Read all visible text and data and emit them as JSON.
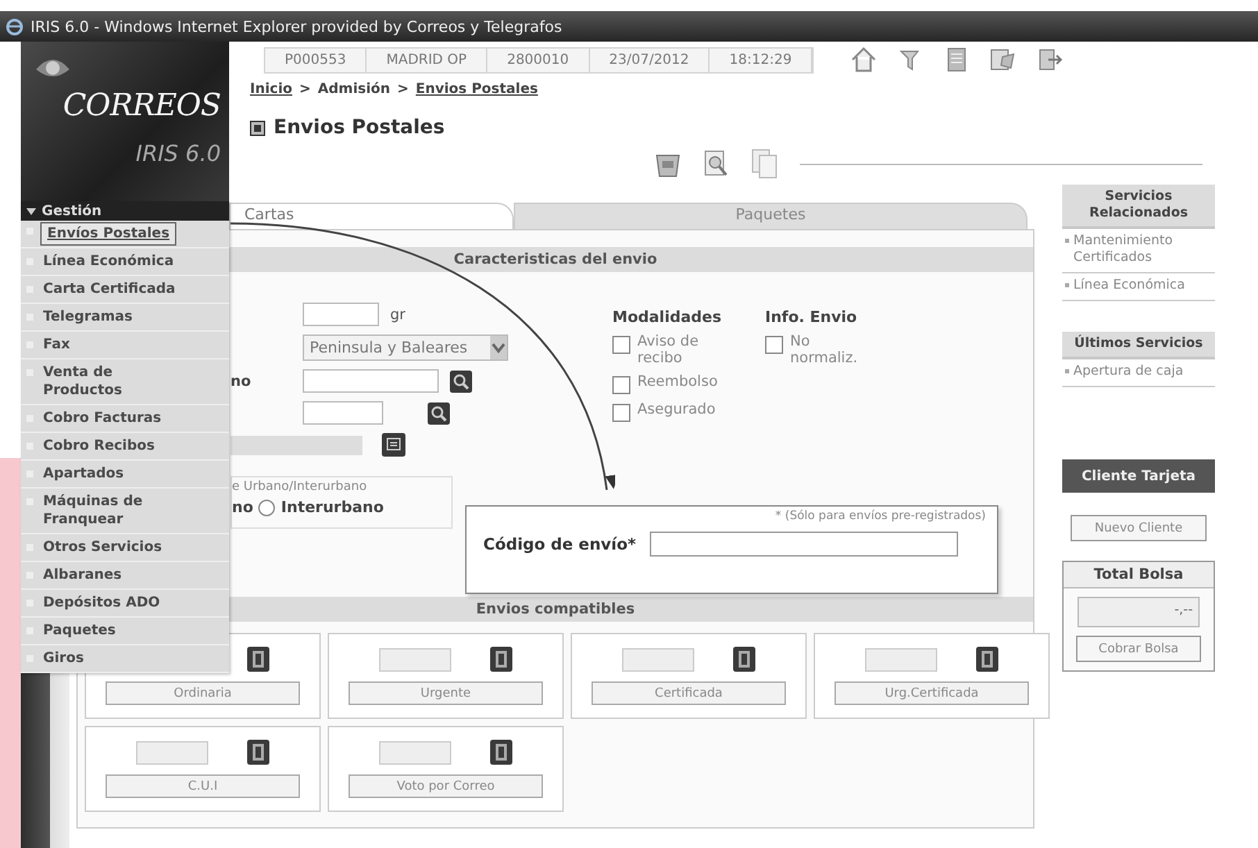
{
  "window": {
    "title": "IRIS 6.0 - Windows Internet Explorer provided by Correos y Telegrafos"
  },
  "logo": {
    "brand": "CORREOS",
    "product": "IRIS 6.0"
  },
  "header": {
    "info": [
      "P000553",
      "MADRID OP",
      "2800010",
      "23/07/2012",
      "18:12:29"
    ],
    "breadcrumb": [
      {
        "label": "Inicio",
        "link": true
      },
      {
        "label": ">",
        "link": false
      },
      {
        "label": "Admisión",
        "link": false
      },
      {
        "label": ">",
        "link": false
      },
      {
        "label": "Envios Postales",
        "link": true
      }
    ],
    "page_title": "Envios Postales"
  },
  "menu": {
    "title": "Gestión",
    "items": [
      {
        "label": "Envíos Postales",
        "selected": true
      },
      {
        "label": "Línea Económica",
        "selected": false
      },
      {
        "label": "Carta Certificada",
        "selected": false
      },
      {
        "label": "Telegramas",
        "selected": false
      },
      {
        "label": "Fax",
        "selected": false
      },
      {
        "label": "Venta de Productos",
        "selected": false
      },
      {
        "label": "Cobro Facturas",
        "selected": false
      },
      {
        "label": "Cobro Recibos",
        "selected": false
      },
      {
        "label": "Apartados",
        "selected": false
      },
      {
        "label": "Máquinas de Franquear",
        "selected": false
      },
      {
        "label": "Otros Servicios",
        "selected": false
      },
      {
        "label": "Albaranes",
        "selected": false
      },
      {
        "label": "Depósitos ADO",
        "selected": false
      },
      {
        "label": "Paquetes",
        "selected": false
      },
      {
        "label": "Giros",
        "selected": false
      }
    ]
  },
  "tabs": [
    {
      "label": "Cartas",
      "selected": true
    },
    {
      "label": "Paquetes",
      "selected": false
    }
  ],
  "form": {
    "section_title": "Caracteristicas del envio",
    "weight_unit": "gr",
    "destination": "Peninsula y Baleares",
    "field_label": "no",
    "zone": {
      "legend": "e Urbano/Interurbano",
      "cut_label": "no",
      "options": [
        {
          "label": "Interurbano",
          "selected": false
        }
      ]
    },
    "modalidades": {
      "title": "Modalidades",
      "options": [
        {
          "label": "Aviso de recibo",
          "checked": false
        },
        {
          "label": "Reembolso",
          "checked": false
        },
        {
          "label": "Asegurado",
          "checked": false
        }
      ]
    },
    "info_envio": {
      "title": "Info. Envio",
      "options": [
        {
          "label": "No normaliz.",
          "checked": false
        }
      ]
    }
  },
  "popup": {
    "note": "* (Sólo para envíos pre-registrados)",
    "label": "Código de envío*"
  },
  "compatibles": {
    "title": "Envios compatibles",
    "items": [
      "Ordinaria",
      "Urgente",
      "Certificada",
      "Urg.Certificada",
      "C.U.I",
      "Voto por Correo"
    ]
  },
  "related": {
    "title": "Servicios Relacionados",
    "links": [
      "Mantenimiento Certificados",
      "Línea Económica"
    ]
  },
  "recent": {
    "title": "Últimos Servicios",
    "links": [
      "Apertura de caja"
    ]
  },
  "client_card_button": "Cliente Tarjeta",
  "new_client_button": "Nuevo Cliente",
  "total_bolsa": {
    "title": "Total Bolsa",
    "value": "-,--",
    "button": "Cobrar Bolsa"
  }
}
